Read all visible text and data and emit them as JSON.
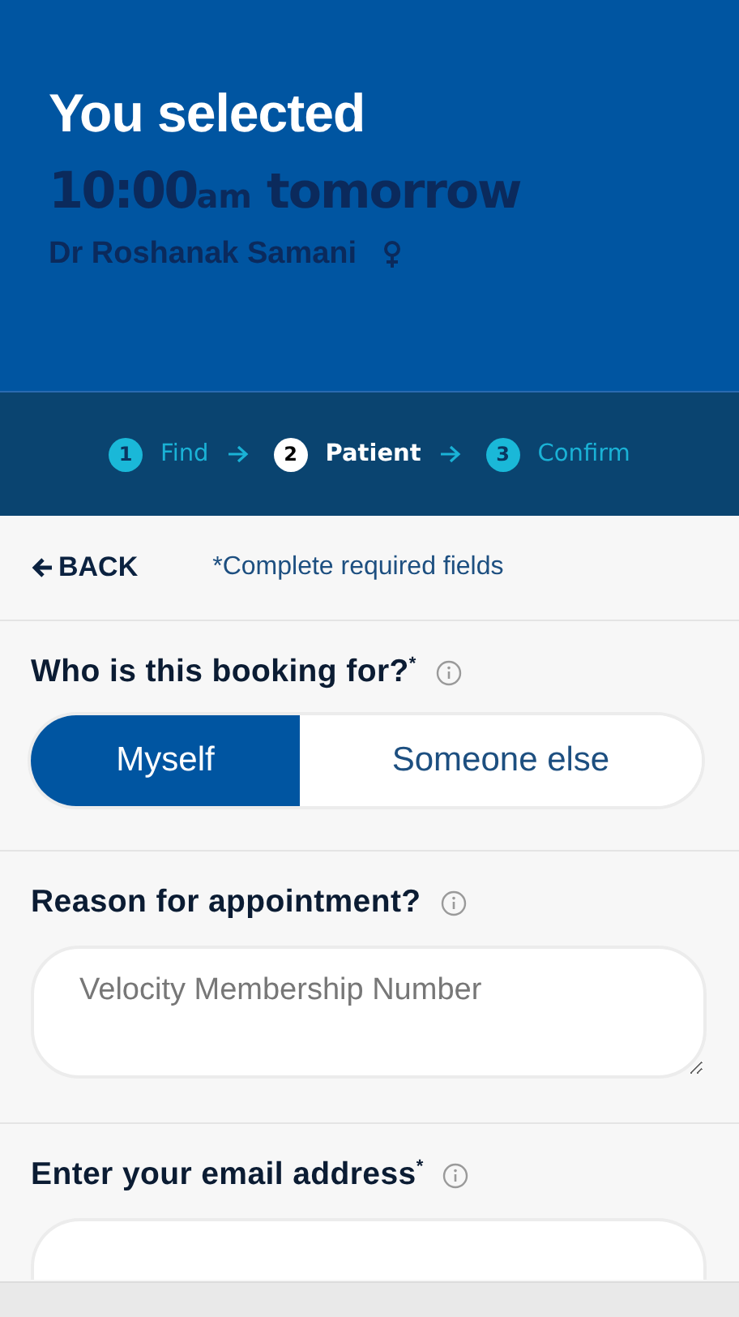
{
  "header": {
    "title": "You selected",
    "time": "10:00",
    "time_suffix": "am",
    "day": "tomorrow",
    "doctor": "Dr Roshanak Samani"
  },
  "steps": [
    {
      "number": "1",
      "label": "Find",
      "selected": false
    },
    {
      "number": "2",
      "label": "Patient",
      "selected": true
    },
    {
      "number": "3",
      "label": "Confirm",
      "selected": false
    }
  ],
  "back": {
    "label": "BACK",
    "note": "*Complete required fields"
  },
  "sections": [
    {
      "kind": "toggle",
      "label": "Who is this booking for?$^{*}$",
      "options": [
        {
          "label": "Myself",
          "selected": true
        },
        {
          "label": "Someone else",
          "selected": false
        }
      ]
    },
    {
      "kind": "textarea",
      "label": "Reason for appointment?",
      "placeholder": "Velocity Membership Number"
    },
    {
      "kind": "input",
      "label": "Enter your email address$^{*}$"
    }
  ]
}
